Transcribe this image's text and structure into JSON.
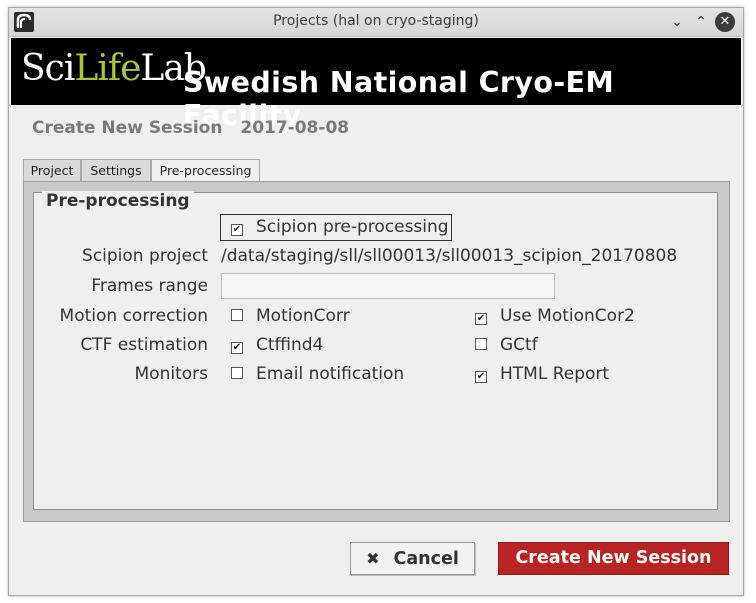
{
  "window": {
    "title": "Projects (hal on cryo-staging)"
  },
  "banner": {
    "logo_part1": "Sci",
    "logo_part2": "Life",
    "logo_part3": "Lab",
    "title": "Swedish National Cryo-EM Facility"
  },
  "session": {
    "heading": "Create New Session",
    "date": "2017-08-08"
  },
  "tabs": [
    {
      "label": "Project"
    },
    {
      "label": "Settings"
    },
    {
      "label": "Pre-processing",
      "active": true
    }
  ],
  "preprocessing": {
    "group_title": "Pre-processing",
    "scipion_preprocessing": {
      "label": "Scipion pre-processing",
      "checked": true
    },
    "scipion_project": {
      "label": "Scipion project",
      "value": "/data/staging/sll/sll00013/sll00013_scipion_20170808"
    },
    "frames_range": {
      "label": "Frames range",
      "value": ""
    },
    "motion_correction": {
      "label": "Motion correction",
      "options": [
        {
          "label": "MotionCorr",
          "checked": false
        },
        {
          "label": "Use MotionCor2",
          "checked": true
        }
      ]
    },
    "ctf_estimation": {
      "label": "CTF estimation",
      "options": [
        {
          "label": "Ctffind4",
          "checked": true
        },
        {
          "label": "GCtf",
          "checked": false
        }
      ]
    },
    "monitors": {
      "label": "Monitors",
      "options": [
        {
          "label": "Email notification",
          "checked": false
        },
        {
          "label": "HTML Report",
          "checked": true
        }
      ]
    }
  },
  "buttons": {
    "cancel": "Cancel",
    "create": "Create New Session"
  },
  "colors": {
    "banner_bg": "#000000",
    "logo_accent": "#a6c63c",
    "primary_button": "#b92323"
  },
  "icons": {
    "app": "app-icon",
    "minimize": "chevron-down-icon",
    "maximize": "chevron-up-icon",
    "close": "close-icon",
    "cancel": "x-icon"
  }
}
